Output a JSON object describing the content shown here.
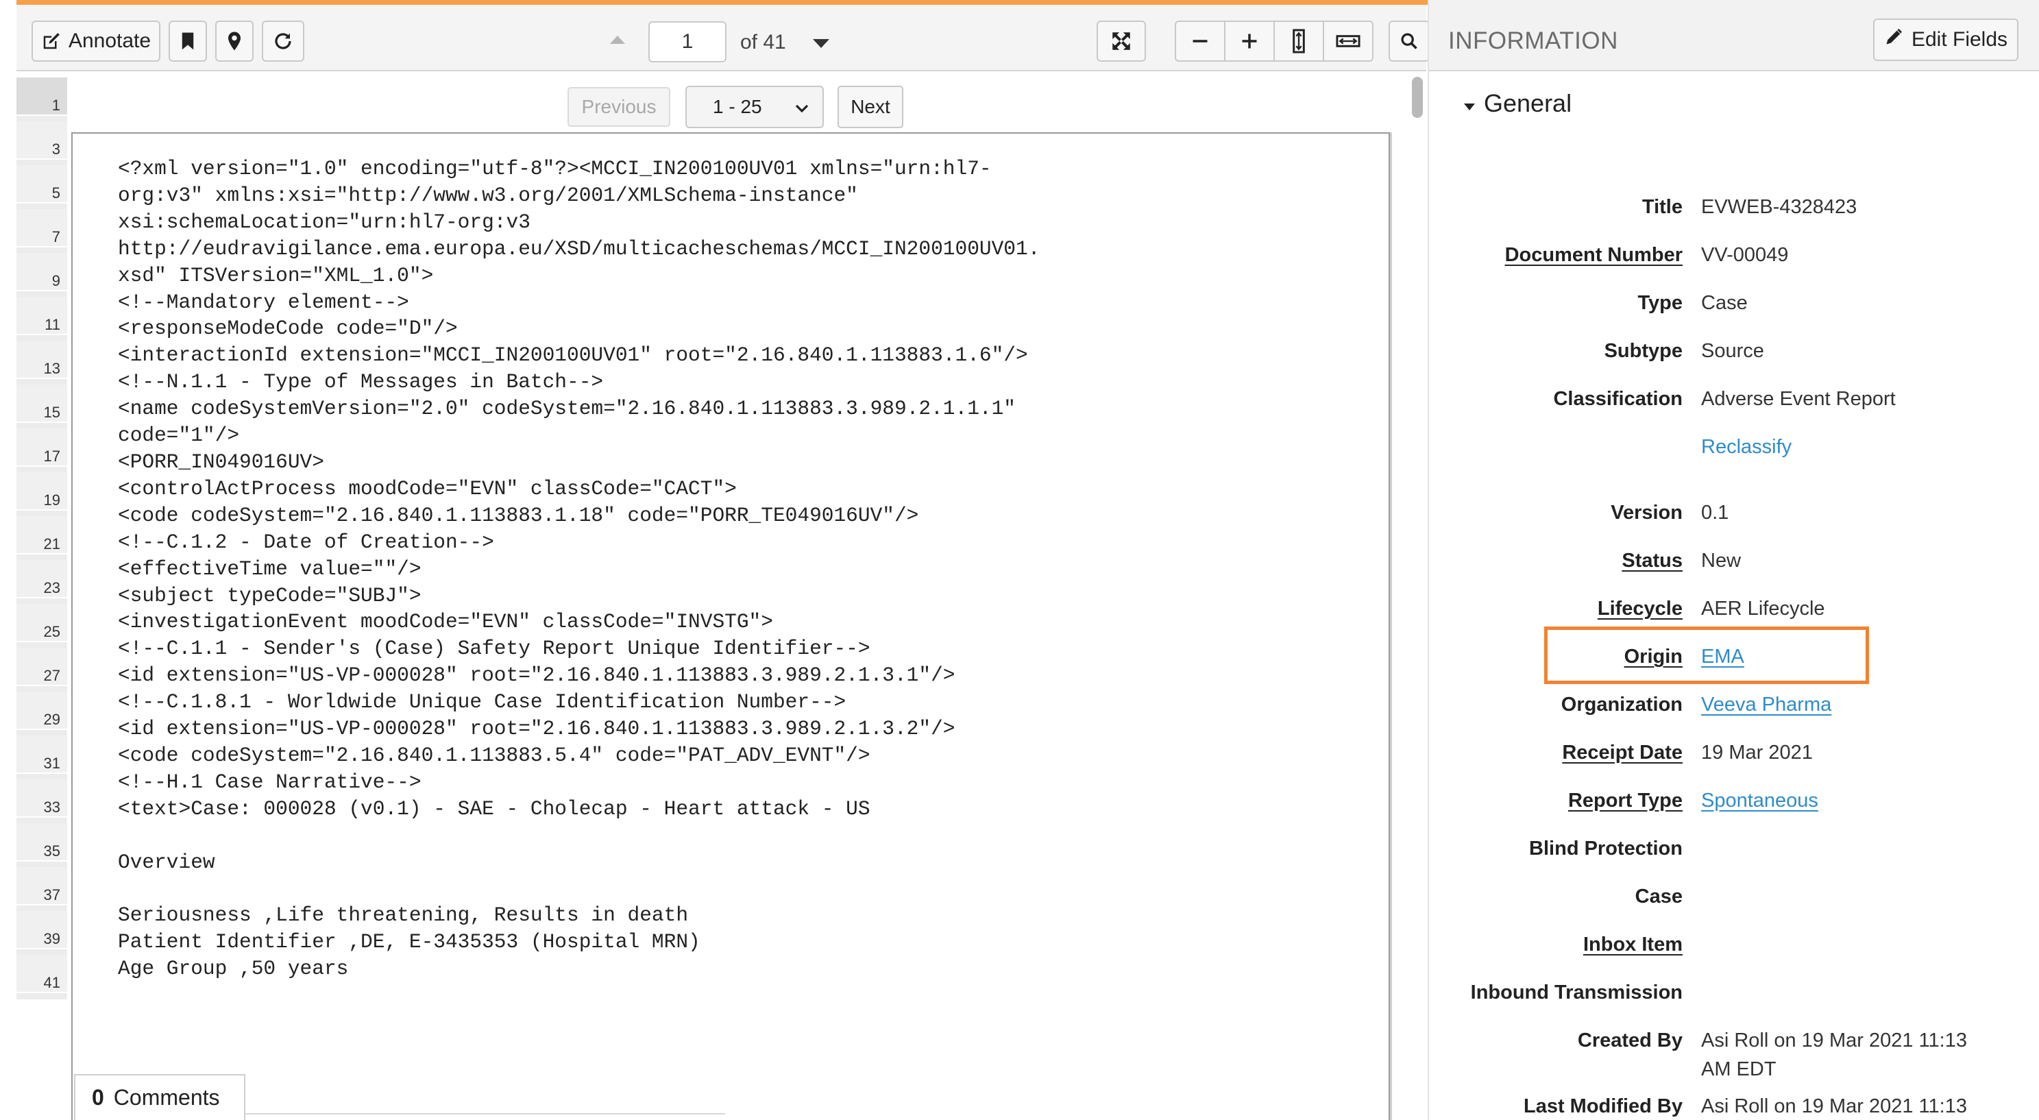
{
  "toolbar": {
    "annotate_label": "Annotate",
    "current_page": "1",
    "page_of": "of 41"
  },
  "pagination": {
    "previous_label": "Previous",
    "range_value": "1 - 25",
    "next_label": "Next"
  },
  "page_rail": [
    "1",
    "3",
    "5",
    "7",
    "9",
    "11",
    "13",
    "15",
    "17",
    "19",
    "21",
    "23",
    "25",
    "27",
    "29",
    "31",
    "33",
    "35",
    "37",
    "39",
    "41"
  ],
  "document_lines": [
    "<?xml version=\"1.0\" encoding=\"utf-8\"?><MCCI_IN200100UV01 xmlns=\"urn:hl7-",
    "org:v3\" xmlns:xsi=\"http://www.w3.org/2001/XMLSchema-instance\"",
    "xsi:schemaLocation=\"urn:hl7-org:v3",
    "http://eudravigilance.ema.europa.eu/XSD/multicacheschemas/MCCI_IN200100UV01.",
    "xsd\" ITSVersion=\"XML_1.0\">",
    "<!--Mandatory element-->",
    "<responseModeCode code=\"D\"/>",
    "<interactionId extension=\"MCCI_IN200100UV01\" root=\"2.16.840.1.113883.1.6\"/>",
    "<!--N.1.1 - Type of Messages in Batch-->",
    "<name codeSystemVersion=\"2.0\" codeSystem=\"2.16.840.1.113883.3.989.2.1.1.1\"",
    "code=\"1\"/>",
    "<PORR_IN049016UV>",
    "<controlActProcess moodCode=\"EVN\" classCode=\"CACT\">",
    "<code codeSystem=\"2.16.840.1.113883.1.18\" code=\"PORR_TE049016UV\"/>",
    "<!--C.1.2 - Date of Creation-->",
    "<effectiveTime value=\"\"/>",
    "<subject typeCode=\"SUBJ\">",
    "<investigationEvent moodCode=\"EVN\" classCode=\"INVSTG\">",
    "<!--C.1.1 - Sender's (Case) Safety Report Unique Identifier-->",
    "<id extension=\"US-VP-000028\" root=\"2.16.840.1.113883.3.989.2.1.3.1\"/>",
    "<!--C.1.8.1 - Worldwide Unique Case Identification Number-->",
    "<id extension=\"US-VP-000028\" root=\"2.16.840.1.113883.3.989.2.1.3.2\"/>",
    "<code codeSystem=\"2.16.840.1.113883.5.4\" code=\"PAT_ADV_EVNT\"/>",
    "<!--H.1 Case Narrative-->",
    "<text>Case: 000028 (v0.1) - SAE - Cholecap - Heart attack - US",
    "",
    "Overview",
    "",
    "Seriousness ,Life threatening, Results in death",
    "Patient Identifier ,DE, E-3435353 (Hospital MRN)",
    "Age Group ,50 years"
  ],
  "comments": {
    "count": "0",
    "label": "Comments"
  },
  "info_panel": {
    "title": "INFORMATION",
    "edit_label": "Edit Fields",
    "section": "General",
    "fields": {
      "title": {
        "label": "Title",
        "value": "EVWEB-4328423"
      },
      "document_number": {
        "label": "Document Number",
        "value": "VV-00049"
      },
      "type": {
        "label": "Type",
        "value": "Case"
      },
      "subtype": {
        "label": "Subtype",
        "value": "Source"
      },
      "classification": {
        "label": "Classification",
        "value": "Adverse Event Report"
      },
      "reclassify": {
        "value": "Reclassify"
      },
      "version": {
        "label": "Version",
        "value": "0.1"
      },
      "status": {
        "label": "Status",
        "value": "New"
      },
      "lifecycle": {
        "label": "Lifecycle",
        "value": "AER Lifecycle"
      },
      "origin": {
        "label": "Origin",
        "value": "EMA"
      },
      "organization": {
        "label": "Organization",
        "value": "Veeva Pharma"
      },
      "receipt_date": {
        "label": "Receipt Date",
        "value": "19 Mar 2021"
      },
      "report_type": {
        "label": "Report Type",
        "value": "Spontaneous"
      },
      "blind_protection": {
        "label": "Blind Protection"
      },
      "case": {
        "label": "Case"
      },
      "inbox_item": {
        "label": "Inbox Item"
      },
      "inbound_transmission": {
        "label": "Inbound Transmission"
      },
      "created_by": {
        "label": "Created By",
        "value_line1": "Asi Roll on 19 Mar 2021 11:13",
        "value_line2": "AM EDT"
      },
      "last_modified_by": {
        "label": "Last Modified By",
        "value_line1": "Asi Roll on 19 Mar 2021 11:13"
      }
    }
  },
  "colors": {
    "accent_bar": "#f5a04a",
    "highlight_box": "#f08232",
    "link": "#2f8bc9"
  }
}
